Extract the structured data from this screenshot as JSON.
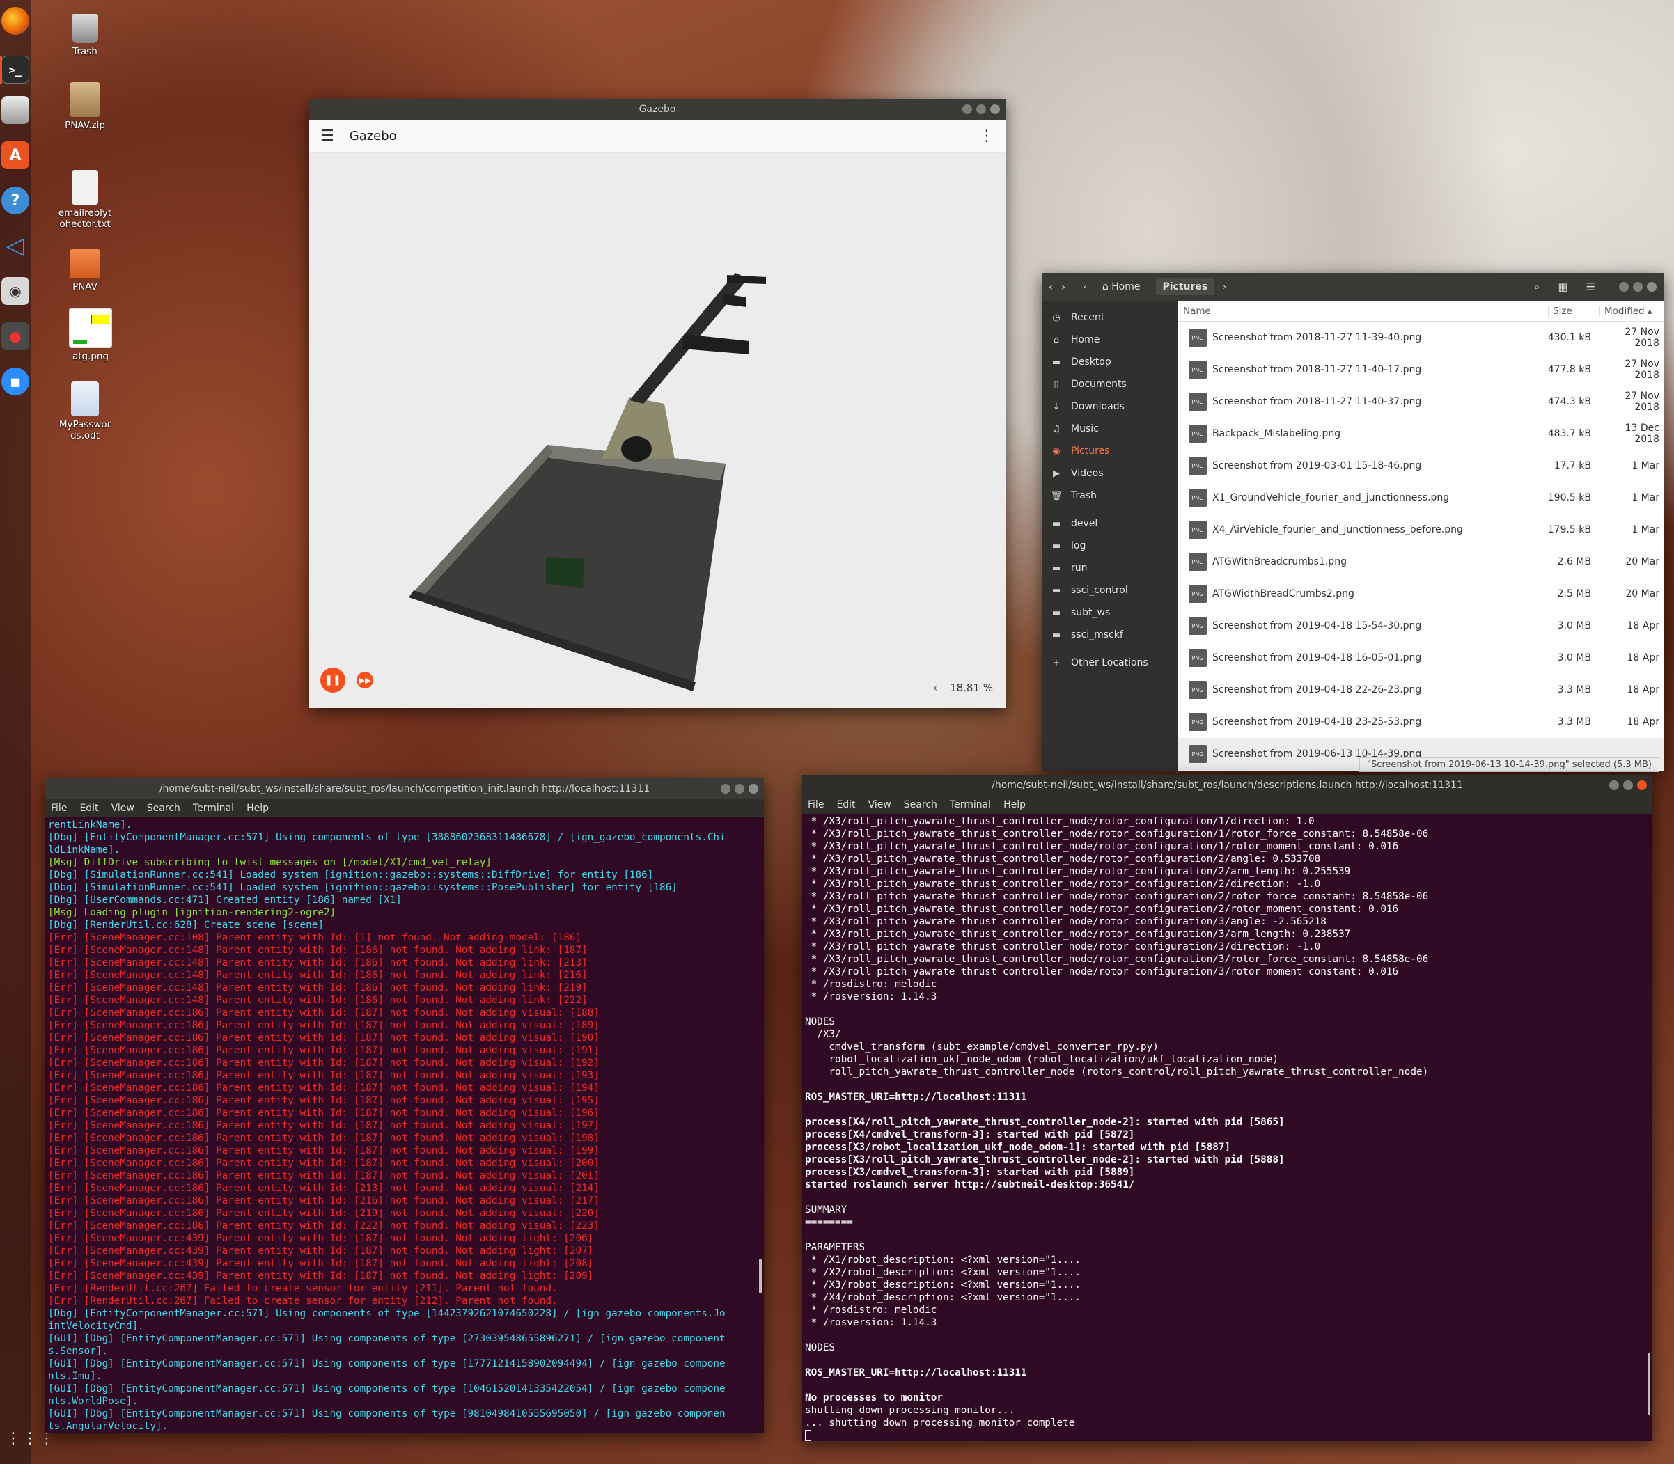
{
  "desktop": {
    "icons": [
      {
        "label": "Trash"
      },
      {
        "label": "PNAV.zip"
      },
      {
        "label": "emailreplytohector.txt"
      },
      {
        "label": "PNAV"
      },
      {
        "label": "atg.png"
      },
      {
        "label": "MyPasswords.odt"
      }
    ]
  },
  "gazebo": {
    "window_title": "Gazebo",
    "app_title": "Gazebo",
    "rtf": "18.81 %"
  },
  "files": {
    "breadcrumbs": [
      "Home",
      "Pictures"
    ],
    "sidebar": [
      "Recent",
      "Home",
      "Desktop",
      "Documents",
      "Downloads",
      "Music",
      "Pictures",
      "Videos",
      "Trash",
      "devel",
      "log",
      "run",
      "ssci_control",
      "subt_ws",
      "ssci_msckf",
      "Other Locations"
    ],
    "columns": {
      "name": "Name",
      "size": "Size",
      "modified": "Modified"
    },
    "rows": [
      {
        "name": "Screenshot from 2018-11-27 11-39-40.png",
        "size": "430.1 kB",
        "modified": "27 Nov 2018"
      },
      {
        "name": "Screenshot from 2018-11-27 11-40-17.png",
        "size": "477.8 kB",
        "modified": "27 Nov 2018"
      },
      {
        "name": "Screenshot from 2018-11-27 11-40-37.png",
        "size": "474.3 kB",
        "modified": "27 Nov 2018"
      },
      {
        "name": "Backpack_Mislabeling.png",
        "size": "483.7 kB",
        "modified": "13 Dec 2018"
      },
      {
        "name": "Screenshot from 2019-03-01 15-18-46.png",
        "size": "17.7 kB",
        "modified": "1 Mar"
      },
      {
        "name": "X1_GroundVehicle_fourier_and_junctionness.png",
        "size": "190.5 kB",
        "modified": "1 Mar"
      },
      {
        "name": "X4_AirVehicle_fourier_and_junctionness_before.png",
        "size": "179.5 kB",
        "modified": "1 Mar"
      },
      {
        "name": "ATGWithBreadcrumbs1.png",
        "size": "2.6 MB",
        "modified": "20 Mar"
      },
      {
        "name": "ATGWidthBreadCrumbs2.png",
        "size": "2.5 MB",
        "modified": "20 Mar"
      },
      {
        "name": "Screenshot from 2019-04-18 15-54-30.png",
        "size": "3.0 MB",
        "modified": "18 Apr"
      },
      {
        "name": "Screenshot from 2019-04-18 16-05-01.png",
        "size": "3.0 MB",
        "modified": "18 Apr"
      },
      {
        "name": "Screenshot from 2019-04-18 22-26-23.png",
        "size": "3.3 MB",
        "modified": "18 Apr"
      },
      {
        "name": "Screenshot from 2019-04-18 23-25-53.png",
        "size": "3.3 MB",
        "modified": "18 Apr"
      },
      {
        "name": "Screenshot from 2019-06-13 10-14-39.png",
        "size": "",
        "modified": ""
      }
    ],
    "status": "\"Screenshot from 2019-06-13 10-14-39.png\" selected (5.3 MB)"
  },
  "term1": {
    "title": "/home/subt-neil/subt_ws/install/share/subt_ros/launch/competition_init.launch http://localhost:11311",
    "menu": [
      "File",
      "Edit",
      "View",
      "Search",
      "Terminal",
      "Help"
    ],
    "lines": [
      {
        "c": "cyan",
        "t": "rentLinkName]."
      },
      {
        "c": "cyan",
        "t": "[Dbg] [EntityComponentManager.cc:571] Using components of type [3888602368311486678] / [ign_gazebo_components.Chi"
      },
      {
        "c": "cyan",
        "t": "ldLinkName]."
      },
      {
        "c": "green",
        "t": "[Msg] DiffDrive subscribing to twist messages on [/model/X1/cmd_vel_relay]"
      },
      {
        "c": "cyan",
        "t": "[Dbg] [SimulationRunner.cc:541] Loaded system [ignition::gazebo::systems::DiffDrive] for entity [186]"
      },
      {
        "c": "cyan",
        "t": "[Dbg] [SimulationRunner.cc:541] Loaded system [ignition::gazebo::systems::PosePublisher] for entity [186]"
      },
      {
        "c": "cyan",
        "t": "[Dbg] [UserCommands.cc:471] Created entity [186] named [X1]"
      },
      {
        "c": "green",
        "t": "[Msg] Loading plugin [ignition-rendering2-ogre2]"
      },
      {
        "c": "cyan",
        "t": "[Dbg] [RenderUtil.cc:628] Create scene [scene]"
      },
      {
        "c": "red",
        "t": "[Err] [SceneManager.cc:108] Parent entity with Id: [1] not found. Not adding model: [186]"
      },
      {
        "c": "red",
        "t": "[Err] [SceneManager.cc:148] Parent entity with Id: [186] not found. Not adding link: [187]"
      },
      {
        "c": "red",
        "t": "[Err] [SceneManager.cc:148] Parent entity with Id: [186] not found. Not adding link: [213]"
      },
      {
        "c": "red",
        "t": "[Err] [SceneManager.cc:148] Parent entity with Id: [186] not found. Not adding link: [216]"
      },
      {
        "c": "red",
        "t": "[Err] [SceneManager.cc:148] Parent entity with Id: [186] not found. Not adding link: [219]"
      },
      {
        "c": "red",
        "t": "[Err] [SceneManager.cc:148] Parent entity with Id: [186] not found. Not adding link: [222]"
      },
      {
        "c": "red",
        "t": "[Err] [SceneManager.cc:186] Parent entity with Id: [187] not found. Not adding visual: [188]"
      },
      {
        "c": "red",
        "t": "[Err] [SceneManager.cc:186] Parent entity with Id: [187] not found. Not adding visual: [189]"
      },
      {
        "c": "red",
        "t": "[Err] [SceneManager.cc:186] Parent entity with Id: [187] not found. Not adding visual: [190]"
      },
      {
        "c": "red",
        "t": "[Err] [SceneManager.cc:186] Parent entity with Id: [187] not found. Not adding visual: [191]"
      },
      {
        "c": "red",
        "t": "[Err] [SceneManager.cc:186] Parent entity with Id: [187] not found. Not adding visual: [192]"
      },
      {
        "c": "red",
        "t": "[Err] [SceneManager.cc:186] Parent entity with Id: [187] not found. Not adding visual: [193]"
      },
      {
        "c": "red",
        "t": "[Err] [SceneManager.cc:186] Parent entity with Id: [187] not found. Not adding visual: [194]"
      },
      {
        "c": "red",
        "t": "[Err] [SceneManager.cc:186] Parent entity with Id: [187] not found. Not adding visual: [195]"
      },
      {
        "c": "red",
        "t": "[Err] [SceneManager.cc:186] Parent entity with Id: [187] not found. Not adding visual: [196]"
      },
      {
        "c": "red",
        "t": "[Err] [SceneManager.cc:186] Parent entity with Id: [187] not found. Not adding visual: [197]"
      },
      {
        "c": "red",
        "t": "[Err] [SceneManager.cc:186] Parent entity with Id: [187] not found. Not adding visual: [198]"
      },
      {
        "c": "red",
        "t": "[Err] [SceneManager.cc:186] Parent entity with Id: [187] not found. Not adding visual: [199]"
      },
      {
        "c": "red",
        "t": "[Err] [SceneManager.cc:186] Parent entity with Id: [187] not found. Not adding visual: [200]"
      },
      {
        "c": "red",
        "t": "[Err] [SceneManager.cc:186] Parent entity with Id: [187] not found. Not adding visual: [201]"
      },
      {
        "c": "red",
        "t": "[Err] [SceneManager.cc:186] Parent entity with Id: [213] not found. Not adding visual: [214]"
      },
      {
        "c": "red",
        "t": "[Err] [SceneManager.cc:186] Parent entity with Id: [216] not found. Not adding visual: [217]"
      },
      {
        "c": "red",
        "t": "[Err] [SceneManager.cc:186] Parent entity with Id: [219] not found. Not adding visual: [220]"
      },
      {
        "c": "red",
        "t": "[Err] [SceneManager.cc:186] Parent entity with Id: [222] not found. Not adding visual: [223]"
      },
      {
        "c": "red",
        "t": "[Err] [SceneManager.cc:439] Parent entity with Id: [187] not found. Not adding light: [206]"
      },
      {
        "c": "red",
        "t": "[Err] [SceneManager.cc:439] Parent entity with Id: [187] not found. Not adding light: [207]"
      },
      {
        "c": "red",
        "t": "[Err] [SceneManager.cc:439] Parent entity with Id: [187] not found. Not adding light: [208]"
      },
      {
        "c": "red",
        "t": "[Err] [SceneManager.cc:439] Parent entity with Id: [187] not found. Not adding light: [209]"
      },
      {
        "c": "red",
        "t": "[Err] [RenderUtil.cc:267] Failed to create sensor for entity [211]. Parent not found."
      },
      {
        "c": "red",
        "t": "[Err] [RenderUtil.cc:267] Failed to create sensor for entity [212]. Parent not found."
      },
      {
        "c": "cyan",
        "t": "[Dbg] [EntityComponentManager.cc:571] Using components of type [14423792621074650228] / [ign_gazebo_components.Jo"
      },
      {
        "c": "cyan",
        "t": "intVelocityCmd]."
      },
      {
        "c": "cyan",
        "t": "[GUI] [Dbg] [EntityComponentManager.cc:571] Using components of type [273039548655896271] / [ign_gazebo_component"
      },
      {
        "c": "cyan",
        "t": "s.Sensor]."
      },
      {
        "c": "cyan",
        "t": "[GUI] [Dbg] [EntityComponentManager.cc:571] Using components of type [17771214158902094494] / [ign_gazebo_compone"
      },
      {
        "c": "cyan",
        "t": "nts.Imu]."
      },
      {
        "c": "cyan",
        "t": "[GUI] [Dbg] [EntityComponentManager.cc:571] Using components of type [10461520141335422054] / [ign_gazebo_compone"
      },
      {
        "c": "cyan",
        "t": "nts.WorldPose]."
      },
      {
        "c": "cyan",
        "t": "[GUI] [Dbg] [EntityComponentManager.cc:571] Using components of type [9810498410555695050] / [ign_gazebo_componen"
      },
      {
        "c": "cyan",
        "t": "ts.AngularVelocity]."
      }
    ]
  },
  "term2": {
    "title": "/home/subt-neil/subt_ws/install/share/subt_ros/launch/descriptions.launch http://localhost:11311",
    "menu": [
      "File",
      "Edit",
      "View",
      "Search",
      "Terminal",
      "Help"
    ],
    "lines": [
      {
        "c": "white",
        "t": " * /X3/roll_pitch_yawrate_thrust_controller_node/rotor_configuration/1/direction: 1.0"
      },
      {
        "c": "white",
        "t": " * /X3/roll_pitch_yawrate_thrust_controller_node/rotor_configuration/1/rotor_force_constant: 8.54858e-06"
      },
      {
        "c": "white",
        "t": " * /X3/roll_pitch_yawrate_thrust_controller_node/rotor_configuration/1/rotor_moment_constant: 0.016"
      },
      {
        "c": "white",
        "t": " * /X3/roll_pitch_yawrate_thrust_controller_node/rotor_configuration/2/angle: 0.533708"
      },
      {
        "c": "white",
        "t": " * /X3/roll_pitch_yawrate_thrust_controller_node/rotor_configuration/2/arm_length: 0.255539"
      },
      {
        "c": "white",
        "t": " * /X3/roll_pitch_yawrate_thrust_controller_node/rotor_configuration/2/direction: -1.0"
      },
      {
        "c": "white",
        "t": " * /X3/roll_pitch_yawrate_thrust_controller_node/rotor_configuration/2/rotor_force_constant: 8.54858e-06"
      },
      {
        "c": "white",
        "t": " * /X3/roll_pitch_yawrate_thrust_controller_node/rotor_configuration/2/rotor_moment_constant: 0.016"
      },
      {
        "c": "white",
        "t": " * /X3/roll_pitch_yawrate_thrust_controller_node/rotor_configuration/3/angle: -2.565218"
      },
      {
        "c": "white",
        "t": " * /X3/roll_pitch_yawrate_thrust_controller_node/rotor_configuration/3/arm_length: 0.238537"
      },
      {
        "c": "white",
        "t": " * /X3/roll_pitch_yawrate_thrust_controller_node/rotor_configuration/3/direction: -1.0"
      },
      {
        "c": "white",
        "t": " * /X3/roll_pitch_yawrate_thrust_controller_node/rotor_configuration/3/rotor_force_constant: 8.54858e-06"
      },
      {
        "c": "white",
        "t": " * /X3/roll_pitch_yawrate_thrust_controller_node/rotor_configuration/3/rotor_moment_constant: 0.016"
      },
      {
        "c": "white",
        "t": " * /rosdistro: melodic"
      },
      {
        "c": "white",
        "t": " * /rosversion: 1.14.3"
      },
      {
        "c": "white",
        "t": ""
      },
      {
        "c": "white",
        "t": "NODES"
      },
      {
        "c": "white",
        "t": "  /X3/"
      },
      {
        "c": "white",
        "t": "    cmdvel_transform (subt_example/cmdvel_converter_rpy.py)"
      },
      {
        "c": "white",
        "t": "    robot_localization_ukf_node_odom (robot_localization/ukf_localization_node)"
      },
      {
        "c": "white",
        "t": "    roll_pitch_yawrate_thrust_controller_node (rotors_control/roll_pitch_yawrate_thrust_controller_node)"
      },
      {
        "c": "white",
        "t": ""
      },
      {
        "c": "bold",
        "t": "ROS_MASTER_URI=http://localhost:11311"
      },
      {
        "c": "white",
        "t": ""
      },
      {
        "c": "bold",
        "t": "process[X4/roll_pitch_yawrate_thrust_controller_node-2]: started with pid [5865]"
      },
      {
        "c": "bold",
        "t": "process[X4/cmdvel_transform-3]: started with pid [5872]"
      },
      {
        "c": "bold",
        "t": "process[X3/robot_localization_ukf_node_odom-1]: started with pid [5887]"
      },
      {
        "c": "bold",
        "t": "process[X3/roll_pitch_yawrate_thrust_controller_node-2]: started with pid [5888]"
      },
      {
        "c": "bold",
        "t": "process[X3/cmdvel_transform-3]: started with pid [5889]"
      },
      {
        "c": "bold",
        "t": "started roslaunch server http://subtneil-desktop:36541/"
      },
      {
        "c": "white",
        "t": ""
      },
      {
        "c": "white",
        "t": "SUMMARY"
      },
      {
        "c": "white",
        "t": "========"
      },
      {
        "c": "white",
        "t": ""
      },
      {
        "c": "white",
        "t": "PARAMETERS"
      },
      {
        "c": "white",
        "t": " * /X1/robot_description: <?xml version=\"1...."
      },
      {
        "c": "white",
        "t": " * /X2/robot_description: <?xml version=\"1...."
      },
      {
        "c": "white",
        "t": " * /X3/robot_description: <?xml version=\"1...."
      },
      {
        "c": "white",
        "t": " * /X4/robot_description: <?xml version=\"1...."
      },
      {
        "c": "white",
        "t": " * /rosdistro: melodic"
      },
      {
        "c": "white",
        "t": " * /rosversion: 1.14.3"
      },
      {
        "c": "white",
        "t": ""
      },
      {
        "c": "white",
        "t": "NODES"
      },
      {
        "c": "white",
        "t": ""
      },
      {
        "c": "bold",
        "t": "ROS_MASTER_URI=http://localhost:11311"
      },
      {
        "c": "white",
        "t": ""
      },
      {
        "c": "bold",
        "t": "No processes to monitor"
      },
      {
        "c": "white",
        "t": "shutting down processing monitor..."
      },
      {
        "c": "white",
        "t": "... shutting down processing monitor complete"
      }
    ]
  }
}
